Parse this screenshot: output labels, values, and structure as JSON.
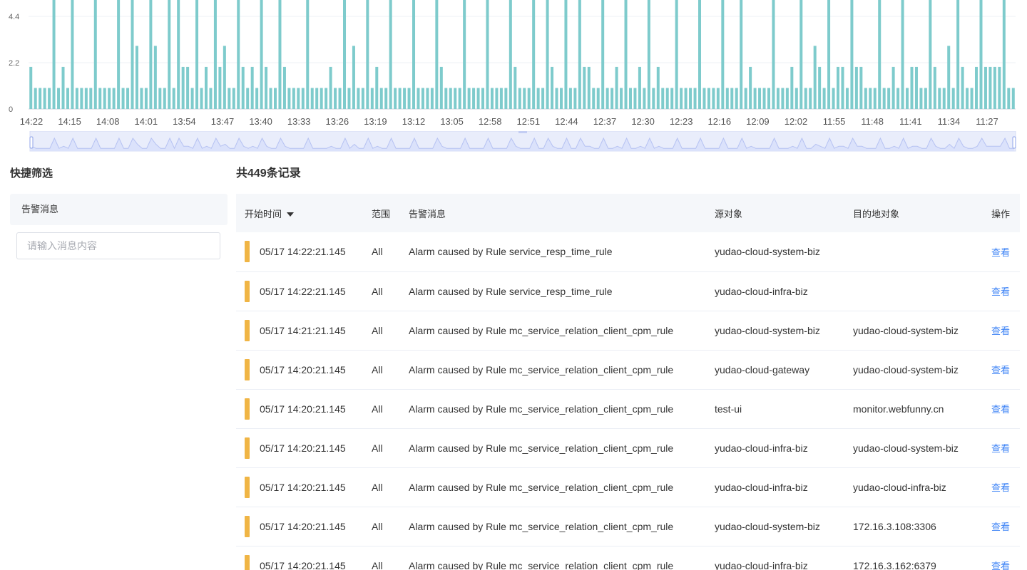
{
  "colors": {
    "bar": "#7ecbcc",
    "slider_bg": "#e9edfb",
    "slider_line": "#b6c2f2",
    "level_warning": "#f0b545",
    "link": "#3b82f6"
  },
  "chart_data": {
    "type": "bar",
    "y_axis": {
      "min": 0,
      "ticks": [
        0,
        2.2,
        4.4
      ],
      "visible_max": 5.2
    },
    "x_tick_labels": [
      "14:22",
      "14:15",
      "14:08",
      "14:01",
      "13:54",
      "13:47",
      "13:40",
      "13:33",
      "13:26",
      "13:19",
      "13:12",
      "13:05",
      "12:58",
      "12:51",
      "12:44",
      "12:37",
      "12:30",
      "12:23",
      "12:16",
      "12:09",
      "12:02",
      "11:55",
      "11:48",
      "11:41",
      "11:34",
      "11:27"
    ],
    "values": [
      2,
      1,
      1,
      1,
      1,
      6,
      1,
      2,
      1,
      6,
      1,
      1,
      1,
      1,
      6,
      1,
      1,
      1,
      1,
      6,
      1,
      1,
      6,
      3,
      1,
      1,
      6,
      3,
      1,
      1,
      6,
      1,
      6,
      2,
      2,
      1,
      6,
      1,
      2,
      1,
      6,
      2,
      3,
      1,
      1,
      6,
      2,
      1,
      2,
      1,
      6,
      2,
      1,
      1,
      6,
      2,
      1,
      1,
      1,
      1,
      6,
      1,
      1,
      1,
      1,
      2,
      1,
      1,
      6,
      1,
      3,
      1,
      1,
      6,
      1,
      2,
      1,
      1,
      6,
      1,
      1,
      1,
      1,
      6,
      1,
      1,
      1,
      1,
      6,
      2,
      1,
      1,
      1,
      1,
      6,
      1,
      1,
      1,
      1,
      6,
      1,
      1,
      1,
      1,
      6,
      2,
      1,
      1,
      1,
      6,
      1,
      1,
      6,
      2,
      1,
      1,
      6,
      1,
      1,
      6,
      2,
      2,
      1,
      1,
      6,
      1,
      1,
      2,
      1,
      6,
      1,
      1,
      2,
      1,
      6,
      1,
      2,
      1,
      1,
      1,
      6,
      1,
      1,
      1,
      1,
      6,
      1,
      1,
      1,
      1,
      6,
      1,
      1,
      1,
      6,
      1,
      2,
      1,
      1,
      1,
      1,
      6,
      1,
      1,
      1,
      2,
      1,
      6,
      1,
      1,
      3,
      2,
      1,
      6,
      1,
      2,
      2,
      1,
      6,
      2,
      2,
      1,
      1,
      1,
      6,
      1,
      1,
      2,
      1,
      6,
      1,
      2,
      2,
      1,
      1,
      6,
      2,
      1,
      1,
      3,
      1,
      6,
      2,
      1,
      1,
      2,
      6,
      2,
      2,
      2,
      2,
      6,
      1,
      1
    ]
  },
  "filter_panel": {
    "title": "快捷筛选",
    "section_label": "告警消息",
    "input_placeholder": "请输入消息内容"
  },
  "records": {
    "count_label": "共449条记录",
    "columns": {
      "start_time": "开始时间",
      "scope": "范围",
      "message": "告警消息",
      "source": "源对象",
      "target": "目的地对象",
      "action": "操作"
    },
    "rows": [
      {
        "time": "05/17 14:22:21.145",
        "scope": "All",
        "message": "Alarm caused by Rule service_resp_time_rule",
        "source": "yudao-cloud-system-biz",
        "target": "",
        "action": "查看"
      },
      {
        "time": "05/17 14:22:21.145",
        "scope": "All",
        "message": "Alarm caused by Rule service_resp_time_rule",
        "source": "yudao-cloud-infra-biz",
        "target": "",
        "action": "查看"
      },
      {
        "time": "05/17 14:21:21.145",
        "scope": "All",
        "message": "Alarm caused by Rule mc_service_relation_client_cpm_rule",
        "source": "yudao-cloud-system-biz",
        "target": "yudao-cloud-system-biz",
        "action": "查看"
      },
      {
        "time": "05/17 14:20:21.145",
        "scope": "All",
        "message": "Alarm caused by Rule mc_service_relation_client_cpm_rule",
        "source": "yudao-cloud-gateway",
        "target": "yudao-cloud-system-biz",
        "action": "查看"
      },
      {
        "time": "05/17 14:20:21.145",
        "scope": "All",
        "message": "Alarm caused by Rule mc_service_relation_client_cpm_rule",
        "source": "test-ui",
        "target": "monitor.webfunny.cn",
        "action": "查看"
      },
      {
        "time": "05/17 14:20:21.145",
        "scope": "All",
        "message": "Alarm caused by Rule mc_service_relation_client_cpm_rule",
        "source": "yudao-cloud-infra-biz",
        "target": "yudao-cloud-system-biz",
        "action": "查看"
      },
      {
        "time": "05/17 14:20:21.145",
        "scope": "All",
        "message": "Alarm caused by Rule mc_service_relation_client_cpm_rule",
        "source": "yudao-cloud-infra-biz",
        "target": "yudao-cloud-infra-biz",
        "action": "查看"
      },
      {
        "time": "05/17 14:20:21.145",
        "scope": "All",
        "message": "Alarm caused by Rule mc_service_relation_client_cpm_rule",
        "source": "yudao-cloud-system-biz",
        "target": "172.16.3.108:3306",
        "action": "查看"
      },
      {
        "time": "05/17 14:20:21.145",
        "scope": "All",
        "message": "Alarm caused by Rule mc_service_relation_client_cpm_rule",
        "source": "yudao-cloud-infra-biz",
        "target": "172.16.3.162:6379",
        "action": "查看"
      }
    ]
  }
}
